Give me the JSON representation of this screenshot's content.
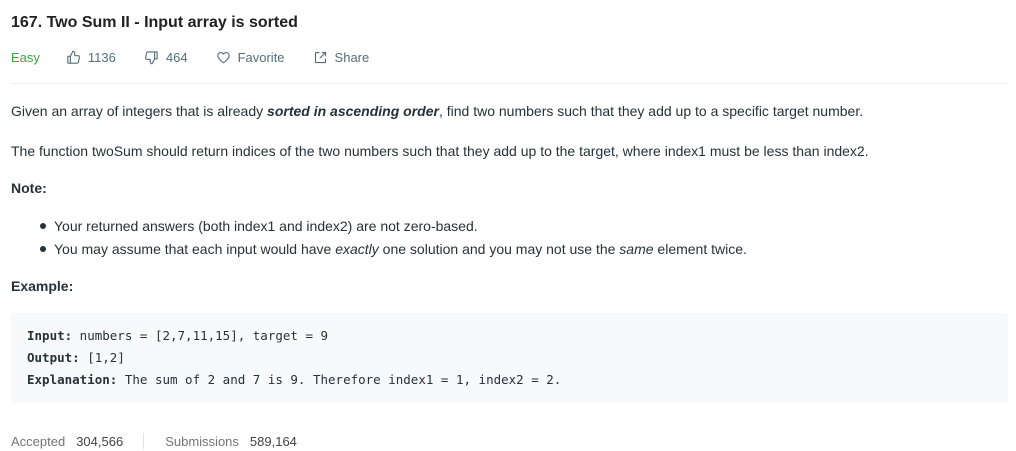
{
  "problem": {
    "title": "167. Two Sum II - Input array is sorted",
    "difficulty": "Easy",
    "likes": "1136",
    "dislikes": "464",
    "favorite_label": "Favorite",
    "share_label": "Share"
  },
  "description": {
    "p1_before": "Given an array of integers that is already ",
    "p1_bold": "sorted in ascending order",
    "p1_after": ", find two numbers such that they add up to a specific target number.",
    "p2": "The function twoSum should return indices of the two numbers such that they add up to the target, where index1 must be less than index2.",
    "note_label": "Note:",
    "bullet1": "Your returned answers (both index1 and index2) are not zero-based.",
    "bullet2_a": "You may assume that each input would have ",
    "bullet2_em1": "exactly",
    "bullet2_b": " one solution and you may not use the ",
    "bullet2_em2": "same",
    "bullet2_c": " element twice.",
    "example_label": "Example:"
  },
  "example": {
    "input_label": "Input:",
    "input_value": " numbers = [2,7,11,15], target = 9",
    "output_label": "Output:",
    "output_value": " [1,2]",
    "explanation_label": "Explanation:",
    "explanation_value": " The sum of 2 and 7 is 9. Therefore index1 = 1, index2 = 2."
  },
  "stats": {
    "accepted_label": "Accepted",
    "accepted_value": "304,566",
    "submissions_label": "Submissions",
    "submissions_value": "589,164"
  },
  "colors": {
    "difficulty_easy": "#43a047",
    "meta_text": "#546e7a",
    "code_bg": "#f7f9fa"
  },
  "icons": [
    "thumbs-up-icon",
    "thumbs-down-icon",
    "heart-icon",
    "share-icon"
  ]
}
